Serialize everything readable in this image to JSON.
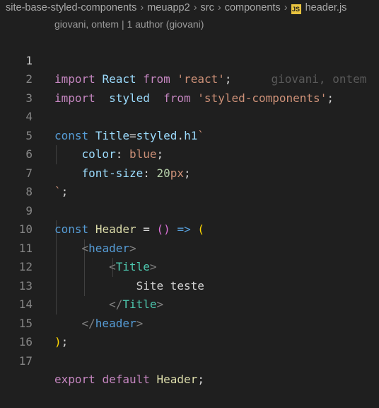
{
  "breadcrumb": {
    "items": [
      "site-base-styled-components",
      "meuapp2",
      "src",
      "components"
    ],
    "file_icon": "JS",
    "file": "header.js"
  },
  "codelens": "giovani, ontem | 1 author (giovani)",
  "blame": "giovani, ontem",
  "line_numbers": [
    "1",
    "2",
    "3",
    "4",
    "5",
    "6",
    "7",
    "8",
    "9",
    "10",
    "11",
    "12",
    "13",
    "14",
    "15",
    "16",
    "17"
  ],
  "tokens": {
    "import": "import",
    "react_id": "React",
    "from": "from",
    "react_str": "'react'",
    "semi": ";",
    "styled_id": "styled",
    "styled_str": "'styled-components'",
    "const": "const",
    "title_id": "Title",
    "eq": "=",
    "styled_obj": "styled",
    "dot": ".",
    "h1": "h1",
    "backtick": "`",
    "color_prop": "color",
    "colon": ":",
    "blue": "blue",
    "fontsize_prop": "font-size",
    "px_num": "20",
    "px_unit": "px",
    "header_id": "Header",
    "eq_sp": " = ",
    "paren_open": "(",
    "paren_close": ")",
    "arrow": "=>",
    "lt": "<",
    "lt_slash": "</",
    "gt": ">",
    "header_tag": "header",
    "title_tag": "Title",
    "text": "Site teste",
    "export": "export",
    "default": "default"
  }
}
